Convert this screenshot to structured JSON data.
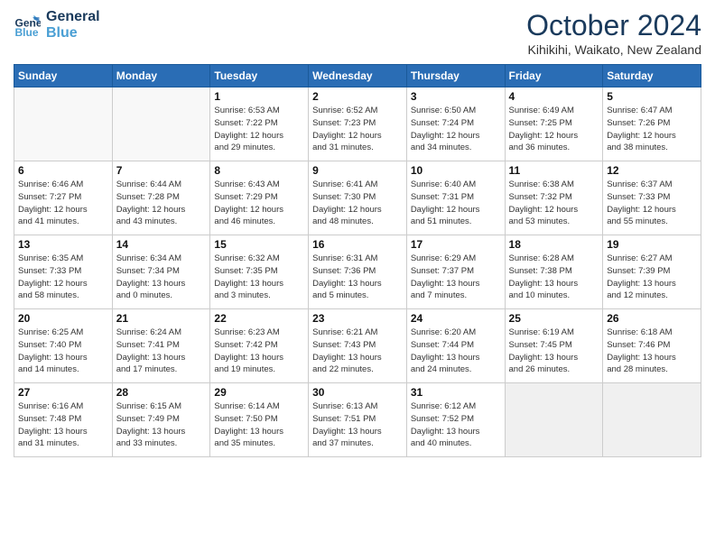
{
  "logo": {
    "line1": "General",
    "line2": "Blue"
  },
  "title": "October 2024",
  "location": "Kihikihi, Waikato, New Zealand",
  "days_of_week": [
    "Sunday",
    "Monday",
    "Tuesday",
    "Wednesday",
    "Thursday",
    "Friday",
    "Saturday"
  ],
  "weeks": [
    [
      {
        "day": "",
        "info": ""
      },
      {
        "day": "",
        "info": ""
      },
      {
        "day": "1",
        "info": "Sunrise: 6:53 AM\nSunset: 7:22 PM\nDaylight: 12 hours\nand 29 minutes."
      },
      {
        "day": "2",
        "info": "Sunrise: 6:52 AM\nSunset: 7:23 PM\nDaylight: 12 hours\nand 31 minutes."
      },
      {
        "day": "3",
        "info": "Sunrise: 6:50 AM\nSunset: 7:24 PM\nDaylight: 12 hours\nand 34 minutes."
      },
      {
        "day": "4",
        "info": "Sunrise: 6:49 AM\nSunset: 7:25 PM\nDaylight: 12 hours\nand 36 minutes."
      },
      {
        "day": "5",
        "info": "Sunrise: 6:47 AM\nSunset: 7:26 PM\nDaylight: 12 hours\nand 38 minutes."
      }
    ],
    [
      {
        "day": "6",
        "info": "Sunrise: 6:46 AM\nSunset: 7:27 PM\nDaylight: 12 hours\nand 41 minutes."
      },
      {
        "day": "7",
        "info": "Sunrise: 6:44 AM\nSunset: 7:28 PM\nDaylight: 12 hours\nand 43 minutes."
      },
      {
        "day": "8",
        "info": "Sunrise: 6:43 AM\nSunset: 7:29 PM\nDaylight: 12 hours\nand 46 minutes."
      },
      {
        "day": "9",
        "info": "Sunrise: 6:41 AM\nSunset: 7:30 PM\nDaylight: 12 hours\nand 48 minutes."
      },
      {
        "day": "10",
        "info": "Sunrise: 6:40 AM\nSunset: 7:31 PM\nDaylight: 12 hours\nand 51 minutes."
      },
      {
        "day": "11",
        "info": "Sunrise: 6:38 AM\nSunset: 7:32 PM\nDaylight: 12 hours\nand 53 minutes."
      },
      {
        "day": "12",
        "info": "Sunrise: 6:37 AM\nSunset: 7:33 PM\nDaylight: 12 hours\nand 55 minutes."
      }
    ],
    [
      {
        "day": "13",
        "info": "Sunrise: 6:35 AM\nSunset: 7:33 PM\nDaylight: 12 hours\nand 58 minutes."
      },
      {
        "day": "14",
        "info": "Sunrise: 6:34 AM\nSunset: 7:34 PM\nDaylight: 13 hours\nand 0 minutes."
      },
      {
        "day": "15",
        "info": "Sunrise: 6:32 AM\nSunset: 7:35 PM\nDaylight: 13 hours\nand 3 minutes."
      },
      {
        "day": "16",
        "info": "Sunrise: 6:31 AM\nSunset: 7:36 PM\nDaylight: 13 hours\nand 5 minutes."
      },
      {
        "day": "17",
        "info": "Sunrise: 6:29 AM\nSunset: 7:37 PM\nDaylight: 13 hours\nand 7 minutes."
      },
      {
        "day": "18",
        "info": "Sunrise: 6:28 AM\nSunset: 7:38 PM\nDaylight: 13 hours\nand 10 minutes."
      },
      {
        "day": "19",
        "info": "Sunrise: 6:27 AM\nSunset: 7:39 PM\nDaylight: 13 hours\nand 12 minutes."
      }
    ],
    [
      {
        "day": "20",
        "info": "Sunrise: 6:25 AM\nSunset: 7:40 PM\nDaylight: 13 hours\nand 14 minutes."
      },
      {
        "day": "21",
        "info": "Sunrise: 6:24 AM\nSunset: 7:41 PM\nDaylight: 13 hours\nand 17 minutes."
      },
      {
        "day": "22",
        "info": "Sunrise: 6:23 AM\nSunset: 7:42 PM\nDaylight: 13 hours\nand 19 minutes."
      },
      {
        "day": "23",
        "info": "Sunrise: 6:21 AM\nSunset: 7:43 PM\nDaylight: 13 hours\nand 22 minutes."
      },
      {
        "day": "24",
        "info": "Sunrise: 6:20 AM\nSunset: 7:44 PM\nDaylight: 13 hours\nand 24 minutes."
      },
      {
        "day": "25",
        "info": "Sunrise: 6:19 AM\nSunset: 7:45 PM\nDaylight: 13 hours\nand 26 minutes."
      },
      {
        "day": "26",
        "info": "Sunrise: 6:18 AM\nSunset: 7:46 PM\nDaylight: 13 hours\nand 28 minutes."
      }
    ],
    [
      {
        "day": "27",
        "info": "Sunrise: 6:16 AM\nSunset: 7:48 PM\nDaylight: 13 hours\nand 31 minutes."
      },
      {
        "day": "28",
        "info": "Sunrise: 6:15 AM\nSunset: 7:49 PM\nDaylight: 13 hours\nand 33 minutes."
      },
      {
        "day": "29",
        "info": "Sunrise: 6:14 AM\nSunset: 7:50 PM\nDaylight: 13 hours\nand 35 minutes."
      },
      {
        "day": "30",
        "info": "Sunrise: 6:13 AM\nSunset: 7:51 PM\nDaylight: 13 hours\nand 37 minutes."
      },
      {
        "day": "31",
        "info": "Sunrise: 6:12 AM\nSunset: 7:52 PM\nDaylight: 13 hours\nand 40 minutes."
      },
      {
        "day": "",
        "info": ""
      },
      {
        "day": "",
        "info": ""
      }
    ]
  ]
}
